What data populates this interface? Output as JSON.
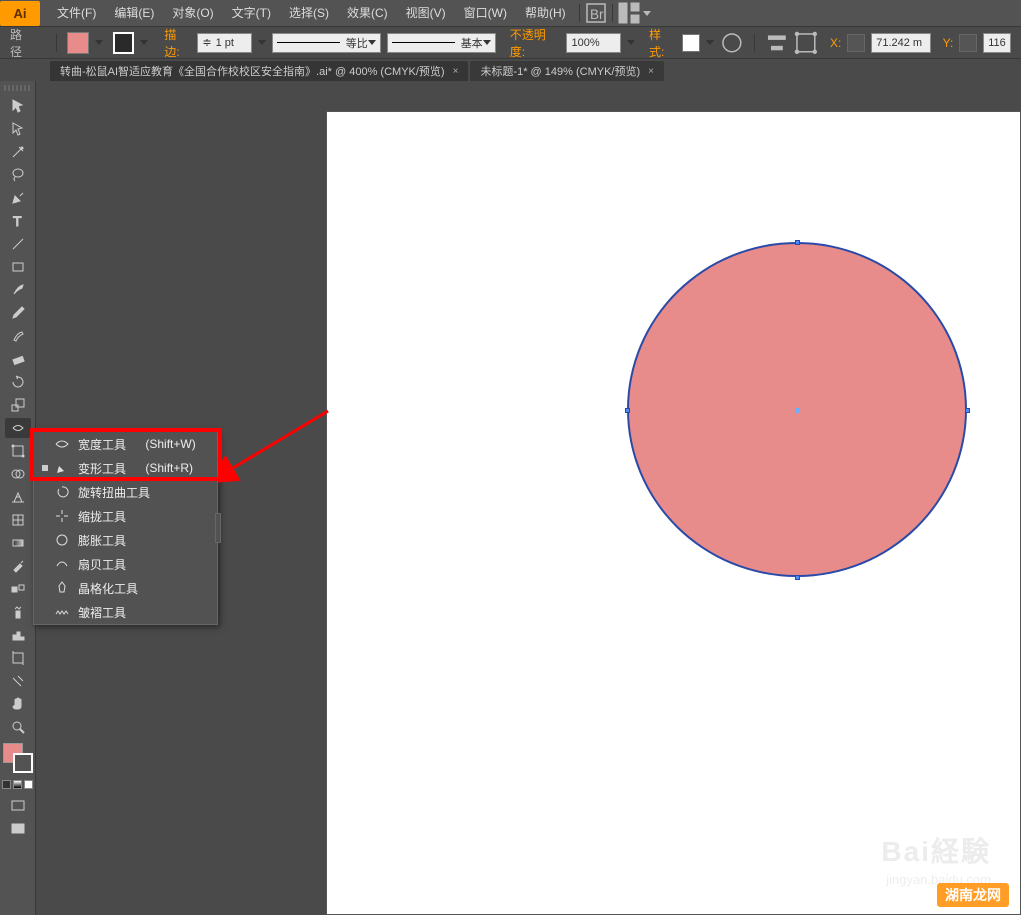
{
  "app": {
    "logo": "Ai"
  },
  "menu": [
    "文件(F)",
    "编辑(E)",
    "对象(O)",
    "文字(T)",
    "选择(S)",
    "效果(C)",
    "视图(V)",
    "窗口(W)",
    "帮助(H)"
  ],
  "control": {
    "path_label": "路径",
    "stroke_label": "描边:",
    "stroke_value": "1 pt",
    "profile_label": "等比",
    "brush_label": "基本",
    "opacity_label": "不透明度:",
    "opacity_value": "100%",
    "style_label": "样式:",
    "x_label": "X:",
    "x_value": "71.242 m",
    "y_label": "Y:",
    "y_value": "116"
  },
  "tabs": [
    {
      "label": "转曲-松鼠AI智适应教育《全国合作校校区安全指南》.ai* @ 400% (CMYK/预览)"
    },
    {
      "label": "未标题-1* @ 149% (CMYK/预览)"
    }
  ],
  "flyout": [
    {
      "label": "宽度工具",
      "shortcut": "(Shift+W)"
    },
    {
      "label": "变形工具",
      "shortcut": "(Shift+R)",
      "current": true
    },
    {
      "label": "旋转扭曲工具",
      "shortcut": ""
    },
    {
      "label": "缩拢工具",
      "shortcut": ""
    },
    {
      "label": "膨胀工具",
      "shortcut": ""
    },
    {
      "label": "扇贝工具",
      "shortcut": ""
    },
    {
      "label": "晶格化工具",
      "shortcut": ""
    },
    {
      "label": "皱褶工具",
      "shortcut": ""
    }
  ],
  "watermark": {
    "main": "Bai経験",
    "sub": "jingyan.baidu.com",
    "corner": "湖南龙网"
  }
}
